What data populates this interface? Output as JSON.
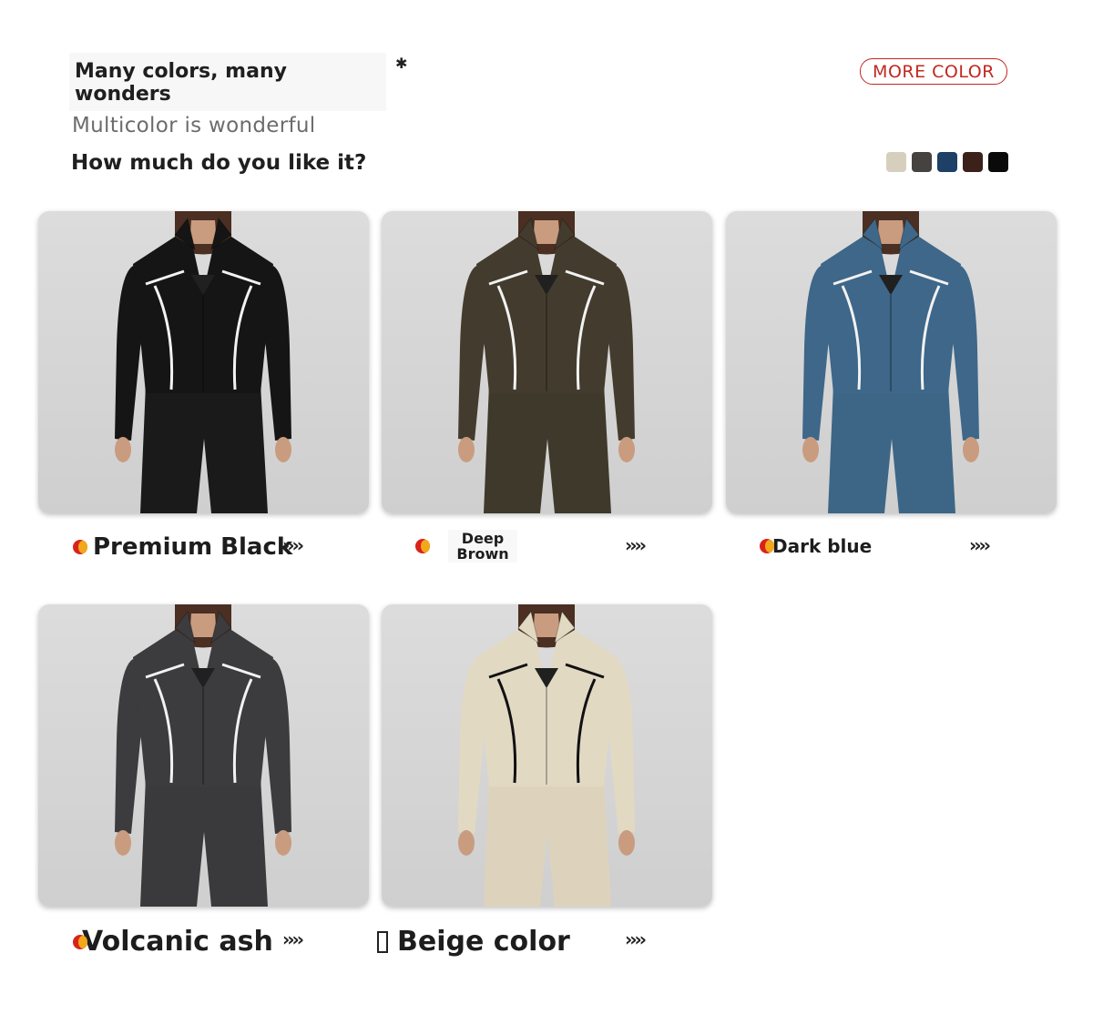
{
  "header": {
    "title": "Many colors, many wonders",
    "asterisk": "✱",
    "subtitle": "Multicolor is wonderful",
    "question": "How much do you like it?",
    "more_button": "MORE COLOR"
  },
  "swatches": [
    {
      "color": "#d7cfbe"
    },
    {
      "color": "#45423f"
    },
    {
      "color": "#1e3f66"
    },
    {
      "color": "#3b211a"
    },
    {
      "color": "#0a0a0a"
    }
  ],
  "products": [
    {
      "label": "Premium Black",
      "chevrons": "››››",
      "top_color": "#151515",
      "legging_color": "#1a1a1a",
      "piping_color": "#f2f2f2"
    },
    {
      "label": "Deep Brown",
      "chevrons": "››››",
      "top_color": "#433c2e",
      "legging_color": "#3f392c",
      "piping_color": "#f2f2f2"
    },
    {
      "label": "Dark blue",
      "chevrons": "››››",
      "top_color": "#3e6789",
      "legging_color": "#3d6686",
      "piping_color": "#f2f2f2"
    },
    {
      "label": "Volcanic ash",
      "chevrons": "››››",
      "top_color": "#3c3b3d",
      "legging_color": "#3a393b",
      "piping_color": "#f2f2f2"
    },
    {
      "label": "Beige color",
      "chevrons": "››››",
      "top_color": "#e2d9c3",
      "legging_color": "#ddd3bd",
      "piping_color": "#111111"
    }
  ],
  "colors": {
    "accent": "#c0281f",
    "skin": "#c99c80",
    "hair": "#4a2f22"
  }
}
